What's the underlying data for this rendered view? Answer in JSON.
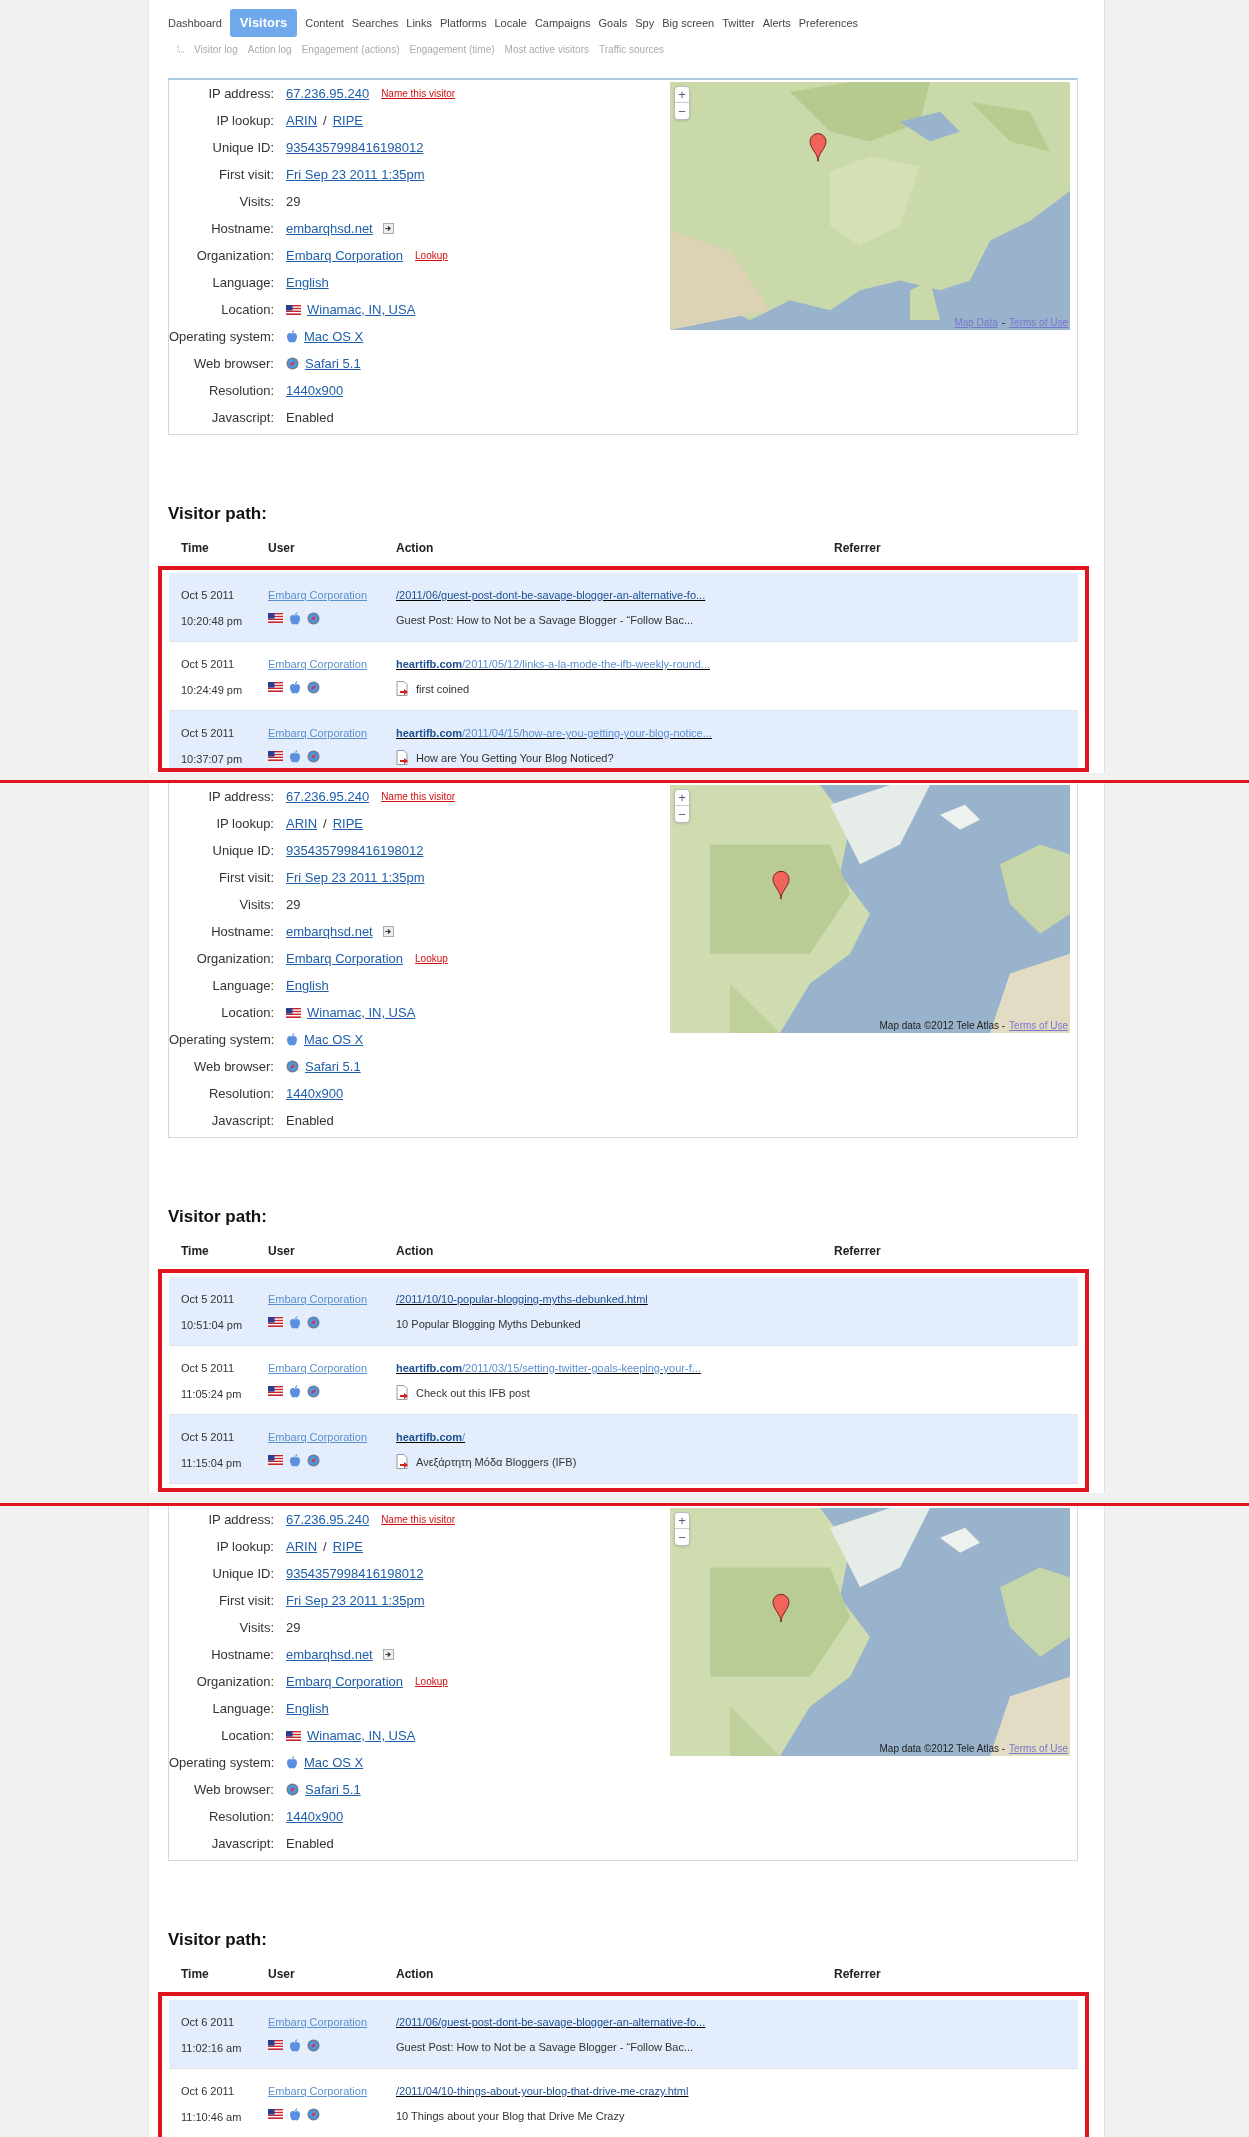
{
  "nav": {
    "tabs": [
      {
        "label": "Dashboard",
        "selected": false
      },
      {
        "label": "Visitors",
        "selected": true
      },
      {
        "label": "Content",
        "selected": false
      },
      {
        "label": "Searches",
        "selected": false
      },
      {
        "label": "Links",
        "selected": false
      },
      {
        "label": "Platforms",
        "selected": false
      },
      {
        "label": "Locale",
        "selected": false
      },
      {
        "label": "Campaigns",
        "selected": false
      },
      {
        "label": "Goals",
        "selected": false
      },
      {
        "label": "Spy",
        "selected": false
      },
      {
        "label": "Big screen",
        "selected": false
      },
      {
        "label": "Twitter",
        "selected": false
      },
      {
        "label": "Alerts",
        "selected": false
      },
      {
        "label": "Preferences",
        "selected": false
      }
    ],
    "subtabs": [
      "Visitor log",
      "Action log",
      "Engagement (actions)",
      "Engagement (time)",
      "Most active visitors",
      "Traffic sources"
    ]
  },
  "snapshots": [
    {
      "details": [
        {
          "kind": "link",
          "label": "IP address:",
          "value": "67.236.95.240",
          "extra": "Name this visitor"
        },
        {
          "kind": "pair",
          "label": "IP lookup:",
          "values": [
            "ARIN",
            "RIPE"
          ],
          "separator": "/"
        },
        {
          "kind": "link",
          "label": "Unique ID:",
          "value": "9354357998416198012"
        },
        {
          "kind": "link",
          "label": "First visit:",
          "value": "Fri Sep 23 2011 1:35pm"
        },
        {
          "kind": "text",
          "label": "Visits:",
          "value": "29"
        },
        {
          "kind": "host",
          "label": "Hostname:",
          "value": "embarqhsd.net"
        },
        {
          "kind": "link",
          "label": "Organization:",
          "value": "Embarq Corporation",
          "extra": "Lookup"
        },
        {
          "kind": "link",
          "label": "Language:",
          "value": "English"
        },
        {
          "kind": "place",
          "label": "Location:",
          "value": "Winamac, IN, USA"
        },
        {
          "kind": "system",
          "label": "Operating system:",
          "value": "Mac OS X"
        },
        {
          "kind": "browser",
          "label": "Web browser:",
          "value": "Safari 5.1"
        },
        {
          "kind": "link",
          "label": "Resolution:",
          "value": "1440x900"
        },
        {
          "kind": "text",
          "label": "Javascript:",
          "value": "Enabled"
        }
      ],
      "map": {
        "zoom_in": "+",
        "zoom_out": "−",
        "attribution": {
          "text": "Map Data",
          "link": true
        },
        "separator": "-",
        "terms": "Terms of Use"
      },
      "path_title": "Visitor path:",
      "columns": [
        "Time",
        "User",
        "Action",
        "Referrer"
      ],
      "rows": [
        {
          "date": "Oct 5 2011",
          "time": "10:20:48 pm",
          "user": "Embarq Corporation",
          "path": "/2011/06/guest-post-dont-be-savage-blogger-an-alternative-fo...",
          "title": "Guest Post: How to Not be a Savage Blogger - “Follow Bac...",
          "outlink": false
        },
        {
          "date": "Oct 5 2011",
          "time": "10:24:49 pm",
          "user": "Embarq Corporation",
          "domain": "heartifb.com",
          "path": "/2011/05/12/links-a-la-mode-the-ifb-weekly-round...",
          "title": "first coined",
          "outlink": true
        },
        {
          "date": "Oct 5 2011",
          "time": "10:37:07 pm",
          "user": "Embarq Corporation",
          "domain": "heartifb.com",
          "path": "/2011/04/15/how-are-you-getting-your-blog-notice...",
          "title": "How are You Getting Your Blog Noticed?",
          "outlink": true
        }
      ]
    },
    {
      "details": [
        {
          "kind": "link",
          "label": "IP address:",
          "value": "67.236.95.240",
          "extra": "Name this visitor"
        },
        {
          "kind": "pair",
          "label": "IP lookup:",
          "values": [
            "ARIN",
            "RIPE"
          ],
          "separator": "/"
        },
        {
          "kind": "link",
          "label": "Unique ID:",
          "value": "9354357998416198012"
        },
        {
          "kind": "link",
          "label": "First visit:",
          "value": "Fri Sep 23 2011 1:35pm"
        },
        {
          "kind": "text",
          "label": "Visits:",
          "value": "29"
        },
        {
          "kind": "host",
          "label": "Hostname:",
          "value": "embarqhsd.net"
        },
        {
          "kind": "link",
          "label": "Organization:",
          "value": "Embarq Corporation",
          "extra": "Lookup"
        },
        {
          "kind": "link",
          "label": "Language:",
          "value": "English"
        },
        {
          "kind": "place",
          "label": "Location:",
          "value": "Winamac, IN, USA"
        },
        {
          "kind": "system",
          "label": "Operating system:",
          "value": "Mac OS X"
        },
        {
          "kind": "browser",
          "label": "Web browser:",
          "value": "Safari 5.1"
        },
        {
          "kind": "link",
          "label": "Resolution:",
          "value": "1440x900"
        },
        {
          "kind": "text",
          "label": "Javascript:",
          "value": "Enabled"
        }
      ],
      "map": {
        "zoom_in": "+",
        "zoom_out": "−",
        "attribution": {
          "text": "Map data ©2012 Tele Atlas -",
          "link": false
        },
        "terms": "Terms of Use"
      },
      "path_title": "Visitor path:",
      "columns": [
        "Time",
        "User",
        "Action",
        "Referrer"
      ],
      "rows": [
        {
          "date": "Oct 5 2011",
          "time": "10:51:04 pm",
          "user": "Embarq Corporation",
          "path": "/2011/10/10-popular-blogging-myths-debunked.html",
          "title": "10 Popular Blogging Myths Debunked",
          "outlink": false
        },
        {
          "date": "Oct 5 2011",
          "time": "11:05:24 pm",
          "user": "Embarq Corporation",
          "domain": "heartifb.com",
          "path": "/2011/03/15/setting-twitter-goals-keeping-your-f...",
          "title": "Check out this IFB post",
          "outlink": true
        },
        {
          "date": "Oct 5 2011",
          "time": "11:15:04 pm",
          "user": "Embarq Corporation",
          "domain": "heartifb.com",
          "path": "/",
          "title": "Ανεξάρτητη Μόδα Bloggers (IFB)",
          "outlink": true
        }
      ]
    },
    {
      "details": [
        {
          "kind": "link",
          "label": "IP address:",
          "value": "67.236.95.240",
          "extra": "Name this visitor"
        },
        {
          "kind": "pair",
          "label": "IP lookup:",
          "values": [
            "ARIN",
            "RIPE"
          ],
          "separator": "/"
        },
        {
          "kind": "link",
          "label": "Unique ID:",
          "value": "9354357998416198012"
        },
        {
          "kind": "link",
          "label": "First visit:",
          "value": "Fri Sep 23 2011 1:35pm"
        },
        {
          "kind": "text",
          "label": "Visits:",
          "value": "29"
        },
        {
          "kind": "host",
          "label": "Hostname:",
          "value": "embarqhsd.net"
        },
        {
          "kind": "link",
          "label": "Organization:",
          "value": "Embarq Corporation",
          "extra": "Lookup"
        },
        {
          "kind": "link",
          "label": "Language:",
          "value": "English"
        },
        {
          "kind": "place",
          "label": "Location:",
          "value": "Winamac, IN, USA"
        },
        {
          "kind": "system",
          "label": "Operating system:",
          "value": "Mac OS X"
        },
        {
          "kind": "browser",
          "label": "Web browser:",
          "value": "Safari 5.1"
        },
        {
          "kind": "link",
          "label": "Resolution:",
          "value": "1440x900"
        },
        {
          "kind": "text",
          "label": "Javascript:",
          "value": "Enabled"
        }
      ],
      "map": {
        "zoom_in": "+",
        "zoom_out": "−",
        "attribution": {
          "text": "Map data ©2012 Tele Atlas -",
          "link": false
        },
        "terms": "Terms of Use"
      },
      "path_title": "Visitor path:",
      "columns": [
        "Time",
        "User",
        "Action",
        "Referrer"
      ],
      "rows": [
        {
          "date": "Oct 6 2011",
          "time": "11:02:16 am",
          "user": "Embarq Corporation",
          "path": "/2011/06/guest-post-dont-be-savage-blogger-an-alternative-fo...",
          "title": "Guest Post: How to Not be a Savage Blogger - “Follow Bac...",
          "outlink": false
        },
        {
          "date": "Oct 6 2011",
          "time": "11:10:46 am",
          "user": "Embarq Corporation",
          "path": "/2011/04/10-things-about-your-blog-that-drive-me-crazy.html",
          "title": "10 Things about your Blog that Drive Me Crazy",
          "outlink": false
        }
      ]
    }
  ]
}
